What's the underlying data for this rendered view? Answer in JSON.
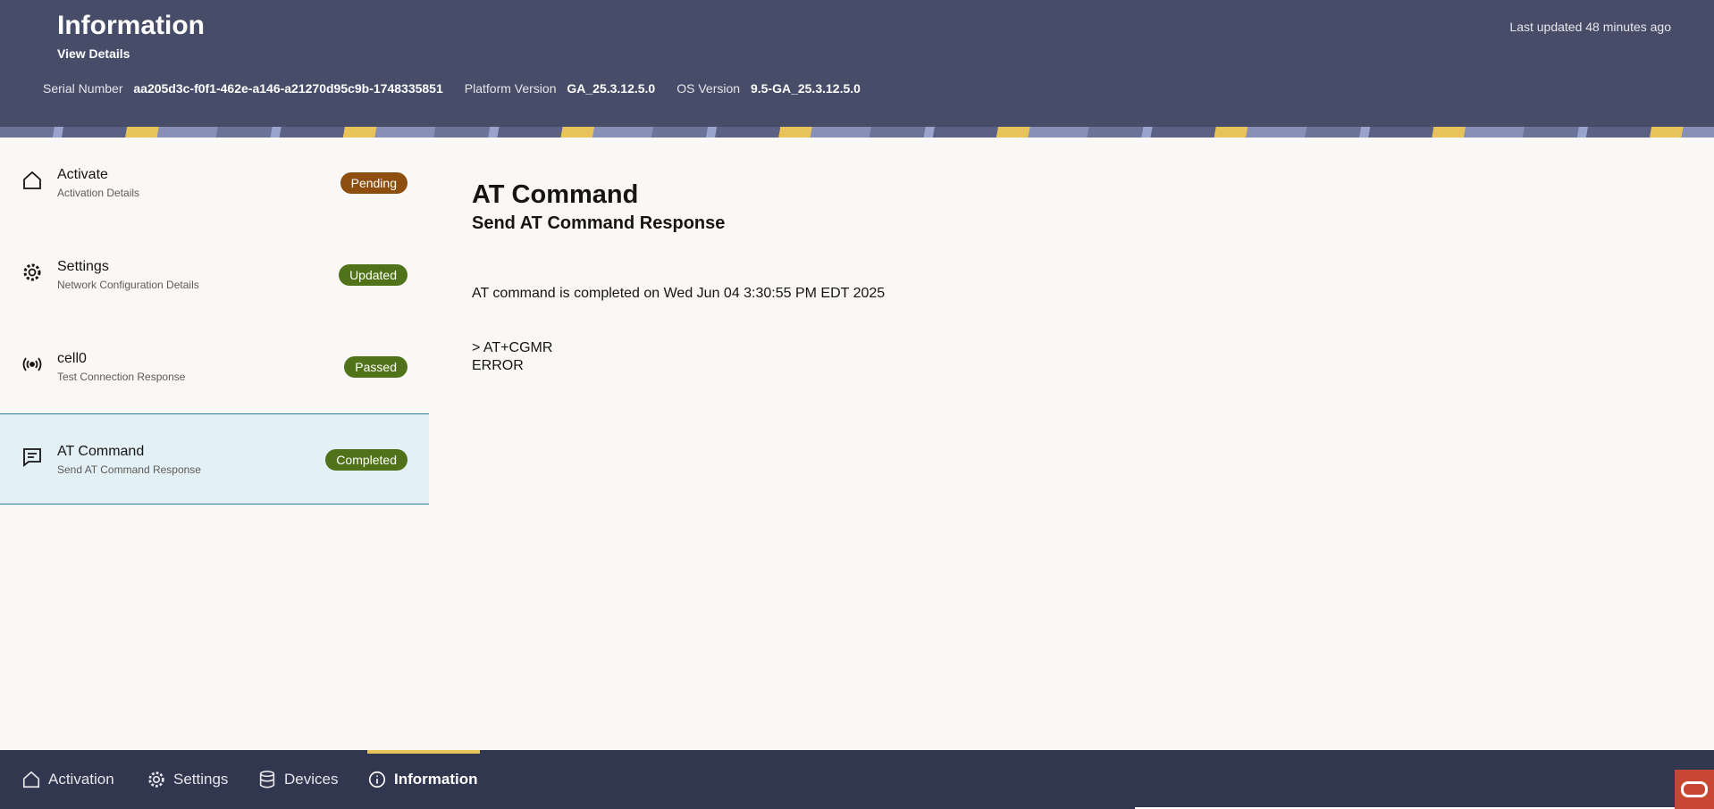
{
  "header": {
    "title": "Information",
    "subtitle": "View Details",
    "last_updated": "Last updated 48 minutes ago",
    "serial_label": "Serial Number",
    "serial_value": "aa205d3c-f0f1-462e-a146-a21270d95c9b-1748335851",
    "platform_label": "Platform Version",
    "platform_value": "GA_25.3.12.5.0",
    "os_label": "OS Version",
    "os_value": "9.5-GA_25.3.12.5.0"
  },
  "list": [
    {
      "icon": "home-icon",
      "name": "Activate",
      "desc": "Activation Details",
      "badge": "Pending",
      "badge_color": "#8d4e10"
    },
    {
      "icon": "gear-icon",
      "name": "Settings",
      "desc": "Network Configuration Details",
      "badge": "Updated",
      "badge_color": "#50731a"
    },
    {
      "icon": "broadcast-icon",
      "name": "cell0",
      "desc": "Test Connection Response",
      "badge": "Passed",
      "badge_color": "#50731a"
    },
    {
      "icon": "message-icon",
      "name": "AT Command",
      "desc": "Send AT Command Response",
      "badge": "Completed",
      "badge_color": "#50731a",
      "active": true
    }
  ],
  "main": {
    "title": "AT Command",
    "subtitle": "Send AT Command Response",
    "status": "AT command is completed on Wed Jun 04 3:30:55 PM EDT 2025",
    "command_output": "> AT+CGMR\nERROR"
  },
  "bottom_nav": [
    {
      "icon": "home-icon",
      "label": "Activation"
    },
    {
      "icon": "gear-icon",
      "label": "Settings"
    },
    {
      "icon": "database-icon",
      "label": "Devices"
    },
    {
      "icon": "info-icon",
      "label": "Information",
      "active": true
    }
  ]
}
